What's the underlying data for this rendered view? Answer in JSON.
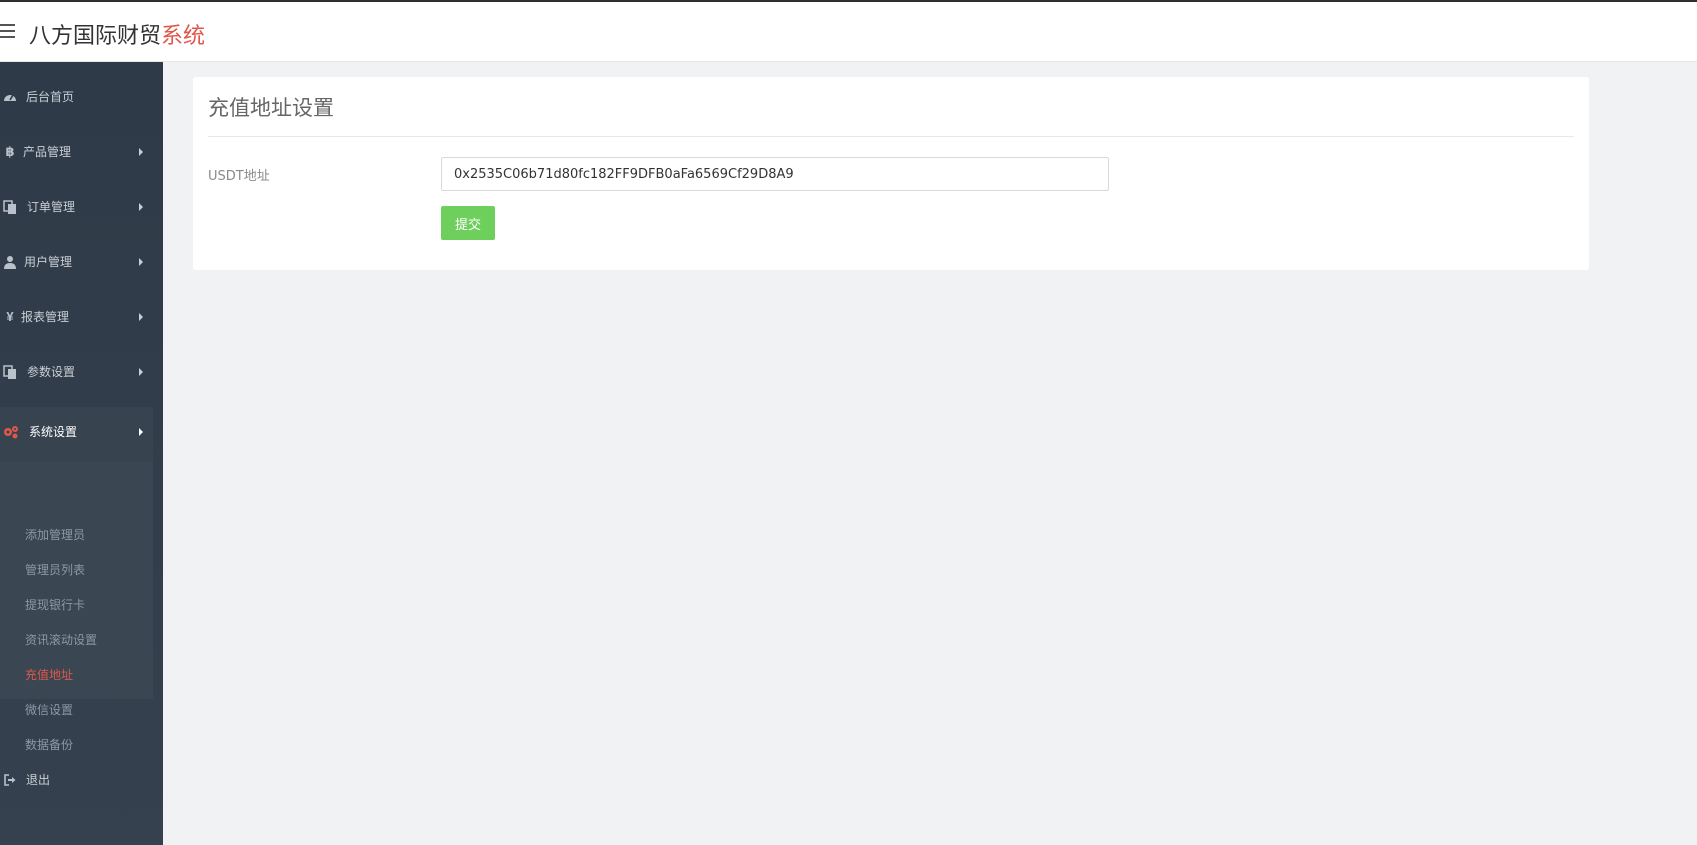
{
  "header": {
    "brand_main": "八方国际财贸",
    "brand_accent": "系统",
    "menu_icon": "hamburger-icon"
  },
  "sidebar": {
    "items": [
      {
        "label": "后台首页",
        "icon": "dashboard-icon"
      },
      {
        "label": "产品管理",
        "icon": "bitcoin-icon"
      },
      {
        "label": "订单管理",
        "icon": "copy-icon"
      },
      {
        "label": "用户管理",
        "icon": "user-icon"
      },
      {
        "label": "报表管理",
        "icon": "yen-icon"
      },
      {
        "label": "参数设置",
        "icon": "copy-icon"
      },
      {
        "label": "系统设置",
        "icon": "gears-icon"
      },
      {
        "label": "退出",
        "icon": "sign-out-icon"
      }
    ],
    "submenu": [
      {
        "label": "添加管理员"
      },
      {
        "label": "管理员列表"
      },
      {
        "label": "提现银行卡"
      },
      {
        "label": "资讯滚动设置"
      },
      {
        "label": "充值地址"
      },
      {
        "label": "微信设置"
      },
      {
        "label": "数据备份"
      }
    ],
    "accent_color": "#e0574a"
  },
  "main": {
    "title": "充值地址设置",
    "field_label": "USDT地址",
    "field_value": "0x2535C06b71d80fc182FF9DFB0aFa6569Cf29D8A9",
    "submit_label": "提交",
    "submit_color": "#6fcf5c"
  }
}
